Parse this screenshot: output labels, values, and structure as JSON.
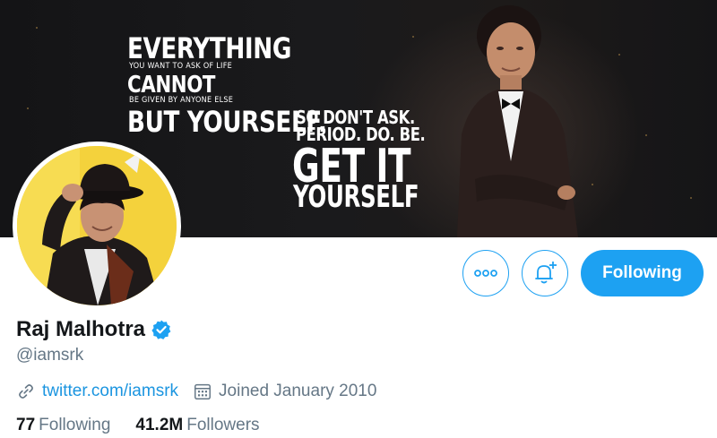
{
  "banner": {
    "quote_line1": "EVERYTHING",
    "quote_line2": "YOU WANT TO ASK OF LIFE",
    "quote_line3": "CANNOT",
    "quote_line4": "BE GIVEN BY ANYONE ELSE",
    "quote_line5": "BUT YOURSELF.",
    "quote_line6": "SO DON'T ASK.",
    "quote_line7": "PERIOD. DO. BE.",
    "quote_line8": "GET IT",
    "quote_line9": "YOURSELF"
  },
  "actions": {
    "more_icon": "more-dots-icon",
    "notify_icon": "bell-plus-icon",
    "follow_label": "Following"
  },
  "profile": {
    "name": "Raj Malhotra",
    "verified": true,
    "handle": "@iamsrk",
    "website": "twitter.com/iamsrk",
    "joined": "Joined January 2010",
    "following_count": "77",
    "following_label": "Following",
    "followers_count": "41.2M",
    "followers_label": "Followers"
  },
  "colors": {
    "accent": "#1da1f2",
    "link": "#1b95e0",
    "muted": "#657786",
    "text": "#14171a"
  }
}
